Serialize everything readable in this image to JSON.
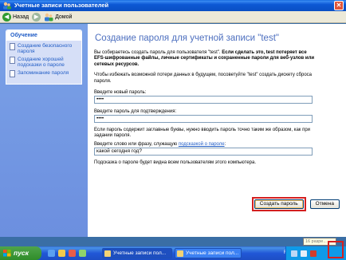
{
  "window": {
    "title": "Учетные записи пользователей"
  },
  "toolbar": {
    "back_label": "Назад",
    "home_label": "Домой"
  },
  "sidebar": {
    "panel_title": "Обучение",
    "items": [
      {
        "label": "Создание безопасного пароля"
      },
      {
        "label": "Создание хорошей подсказки о пароле"
      },
      {
        "label": "Запоминание пароля"
      }
    ]
  },
  "main": {
    "heading": "Создание пароля для учетной записи \"test\"",
    "intro_plain": "Вы собираетесь создать пароль для пользователя \"test\". ",
    "intro_bold": "Если сделать это, test потеряет все EFS-шифрованные файлы, личные сертификаты и сохраненные пароли для веб-узлов или сетевых ресурсов.",
    "reset_disk_note": "Чтобы избежать возможной потери данных в будущем, посоветуйте \"test\" создать дискету сброса пароля.",
    "new_password_label": "Введите новый пароль:",
    "new_password_value": "••••",
    "confirm_password_label": "Введите пароль для подтверждения:",
    "confirm_password_value": "••••",
    "case_note": "Если пароль содержит заглавные буквы, нужно вводить пароль точно таким же образом, как при задании пароля.",
    "hint_label_prefix": "Введите слово или фразу, служащую ",
    "hint_link": "подсказкой о пароле",
    "hint_label_suffix": ":",
    "hint_value": "какой сегодня год?",
    "hint_visible_note": "Подсказка о пароле будет видна всем пользователям этого компьютера.",
    "create_button": "Создать пароль",
    "cancel_button": "Отмена"
  },
  "taskbar": {
    "start_label": "пуск",
    "tasks": [
      {
        "label": "Учетные записи пол..."
      },
      {
        "label": "Учетные записи пол..."
      }
    ],
    "language": "RU",
    "tooltip_fragment": "16 разре..."
  },
  "colors": {
    "title_bar": "#0a4fc4",
    "heading": "#4d6fbf",
    "link": "#215dc6",
    "highlight": "#d42020",
    "taskbar": "#2157d7",
    "start": "#2f8c2a"
  }
}
